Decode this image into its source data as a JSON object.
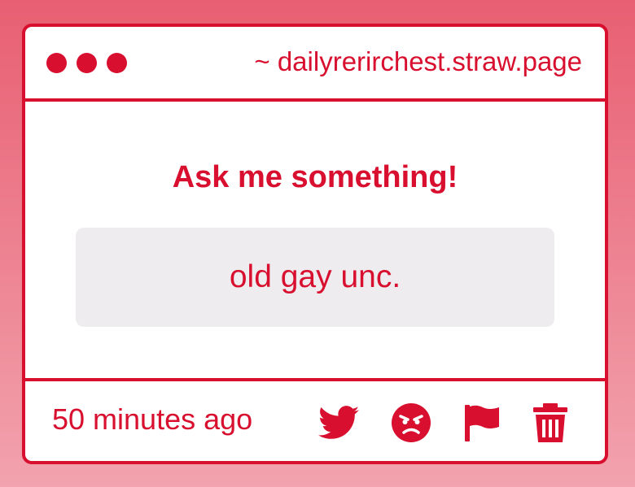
{
  "window": {
    "url": "~ dailyrerirchest.straw.page"
  },
  "content": {
    "heading": "Ask me something!",
    "question": "old gay unc."
  },
  "footer": {
    "timestamp": "50 minutes ago",
    "actions": [
      "twitter-icon",
      "angry-face-icon",
      "flag-icon",
      "trash-icon"
    ]
  },
  "colors": {
    "accent": "#d80f2e",
    "box": "#eeecee",
    "background_top": "#e85f72",
    "background_bottom": "#f2a3ae"
  }
}
